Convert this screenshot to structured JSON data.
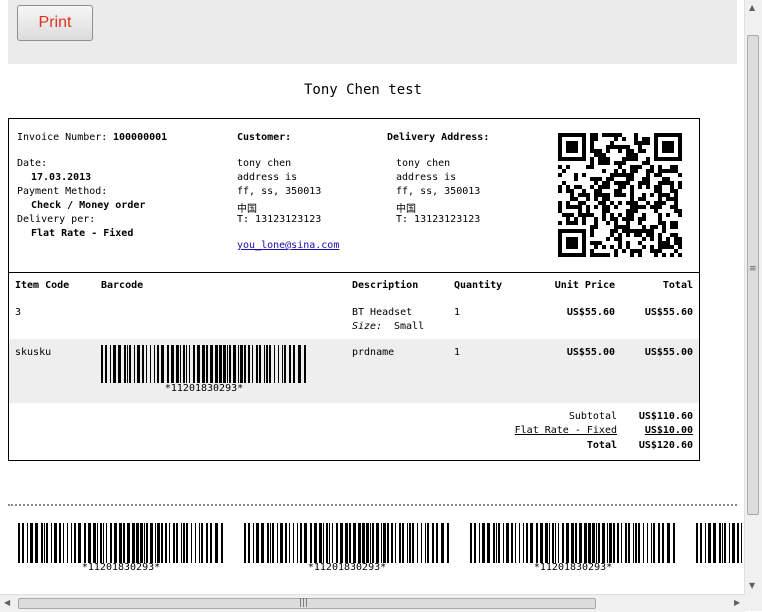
{
  "toolbar": {
    "print_label": "Print"
  },
  "document": {
    "title": "Tony Chen test"
  },
  "invoice": {
    "number_label": "Invoice Number:",
    "number": "100000001",
    "date_label": "Date:",
    "date": "17.03.2013",
    "payment_label": "Payment Method:",
    "payment": "Check / Money order",
    "delivery_label": "Delivery per:",
    "delivery": "Flat Rate - Fixed",
    "customer": {
      "heading": "Customer:",
      "name": "tony chen",
      "address1": "address is",
      "address2": "ff, ss, 350013",
      "country": "中国",
      "phone": "T: 13123123123",
      "email": "you_lone@sina.com"
    },
    "delivery_address": {
      "heading": "Delivery Address:",
      "name": "tony chen",
      "address1": "address is",
      "address2": "ff, ss, 350013",
      "country": "中国",
      "phone": "T: 13123123123"
    },
    "columns": {
      "item_code": "Item Code",
      "barcode": "Barcode",
      "description": "Description",
      "quantity": "Quantity",
      "unit_price": "Unit Price",
      "total": "Total"
    },
    "rows": [
      {
        "code": "3",
        "description": "BT Headset",
        "option_label": "Size:",
        "option_value": "Small",
        "quantity": "1",
        "unit_price": "US$55.60",
        "total": "US$55.60"
      },
      {
        "code": "skusku",
        "description": "prdname",
        "barcode_text": "*11201830293*",
        "quantity": "1",
        "unit_price": "US$55.00",
        "total": "US$55.00"
      }
    ],
    "totals": {
      "subtotal_label": "Subtotal",
      "subtotal": "US$110.60",
      "shipping_label": "Flat Rate - Fixed",
      "shipping": "US$10.00",
      "total_label": "Total",
      "total": "US$120.60"
    }
  },
  "labels": [
    "*11201830293*",
    "*11201830293*",
    "*11201830293*"
  ],
  "scrollbar": {
    "h_grip": "|||",
    "v_grip": "≡"
  }
}
